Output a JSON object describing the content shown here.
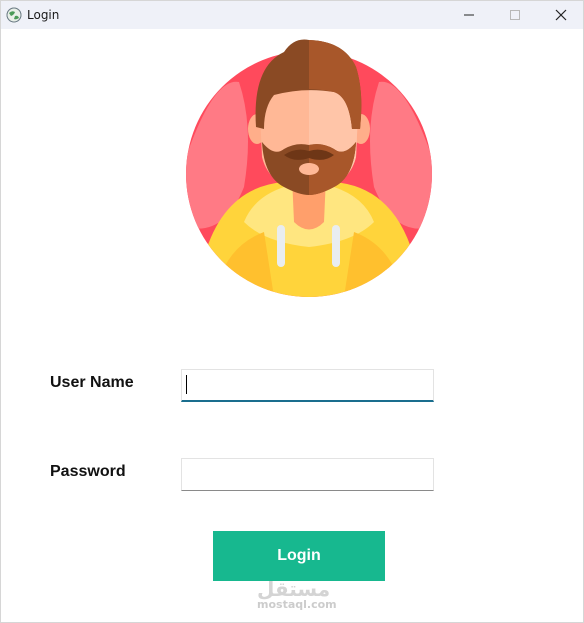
{
  "window": {
    "title": "Login",
    "icon": "app-globe-icon",
    "controls": [
      "minimize-icon",
      "maximize-icon",
      "close-icon"
    ]
  },
  "avatar": {
    "icon": "bearded-man-avatar-icon"
  },
  "form": {
    "username_label": "User Name",
    "username_value": "",
    "password_label": "Password",
    "password_value": "",
    "login_label": "Login"
  },
  "watermark": {
    "arabic": "مستقل",
    "latin": "mostaql.com"
  },
  "colors": {
    "titlebar": "#eff1f8",
    "login_button": "#17b88f",
    "focus_underline": "#1a6e8e",
    "avatar_bg": "#ff5b6d"
  }
}
